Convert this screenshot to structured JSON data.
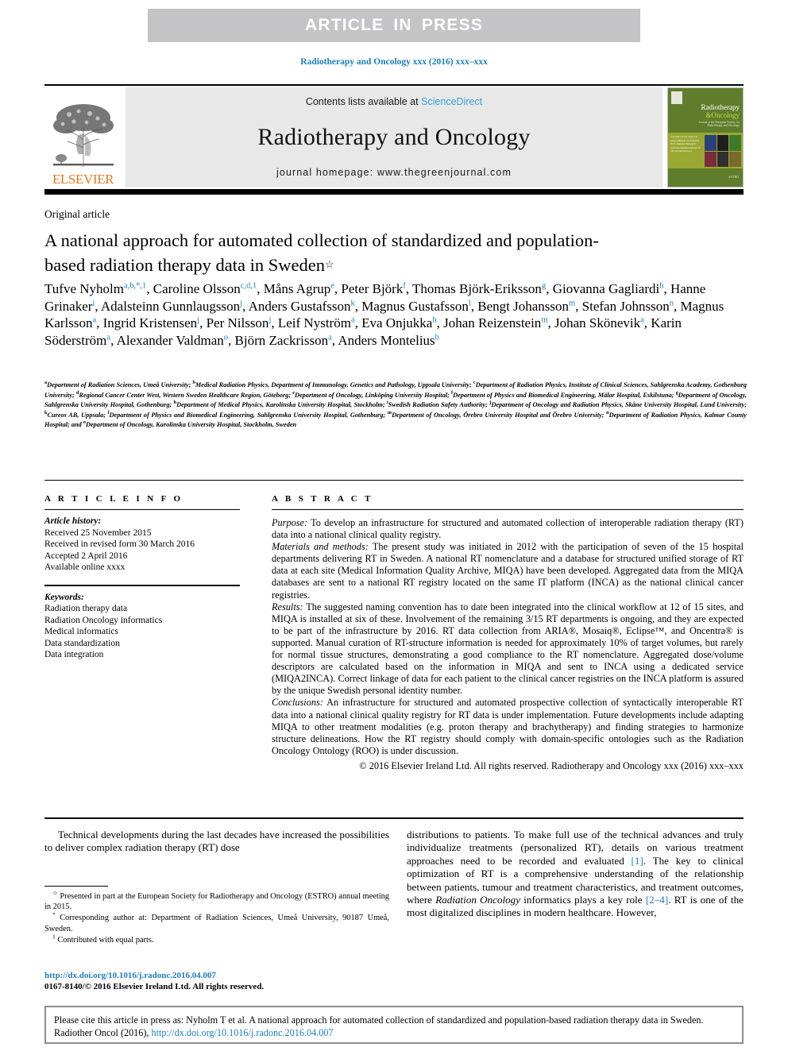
{
  "banner": {
    "label": "ARTICLE IN PRESS"
  },
  "running_head": "Radiotherapy and Oncology xxx (2016) xxx–xxx",
  "masthead": {
    "publisher_wordmark": "ELSEVIER",
    "contents_prefix": "Contents lists available at ",
    "contents_link": "ScienceDirect",
    "journal_name": "Radiotherapy and Oncology",
    "homepage_line": "journal homepage: www.thegreenjournal.com",
    "cover": {
      "title_line1": "Radiotherapy",
      "title_line2": "&Oncology",
      "subtitle": "Journal of the European Society for Radiotherapy and Oncology",
      "blurb": "Towards a Low-dose CT-based Method for Treating HCC Patients Research episodes metamorphoses of 2D reconstruction q",
      "footer_logo": "ESTRO"
    }
  },
  "article_type": "Original article",
  "title": {
    "text": "A national approach for automated collection of standardized and population-based radiation therapy data in Sweden",
    "footnote_marker": "☆"
  },
  "authors": [
    {
      "name": "Tufve Nyholm",
      "marks": "a,b,*,1",
      "sep": ", "
    },
    {
      "name": "Caroline Olsson",
      "marks": "c,d,1",
      "sep": ", "
    },
    {
      "name": "Måns Agrup",
      "marks": "e",
      "sep": ", "
    },
    {
      "name": "Peter Björk",
      "marks": "f",
      "sep": ", "
    },
    {
      "name": "Thomas Björk-Eriksson",
      "marks": "g",
      "sep": ", "
    },
    {
      "name": "Giovanna Gagliardi",
      "marks": "h",
      "sep": ", "
    },
    {
      "name": "Hanne Grinaker",
      "marks": "i",
      "sep": ", "
    },
    {
      "name": "Adalsteinn Gunnlaugsson",
      "marks": "j",
      "sep": ", "
    },
    {
      "name": "Anders Gustafsson",
      "marks": "k",
      "sep": ", "
    },
    {
      "name": "Magnus Gustafsson",
      "marks": "l",
      "sep": ", "
    },
    {
      "name": "Bengt Johansson",
      "marks": "m",
      "sep": ", "
    },
    {
      "name": "Stefan Johnsson",
      "marks": "n",
      "sep": ", "
    },
    {
      "name": "Magnus Karlsson",
      "marks": "a",
      "sep": ", "
    },
    {
      "name": "Ingrid Kristensen",
      "marks": "j",
      "sep": ", "
    },
    {
      "name": "Per Nilsson",
      "marks": "j",
      "sep": ", "
    },
    {
      "name": "Leif Nyström",
      "marks": "a",
      "sep": ", "
    },
    {
      "name": "Eva Onjukka",
      "marks": "h",
      "sep": ", "
    },
    {
      "name": "Johan Reizenstein",
      "marks": "m",
      "sep": ", "
    },
    {
      "name": "Johan Skönevik",
      "marks": "a",
      "sep": ", "
    },
    {
      "name": "Karin Söderström",
      "marks": "a",
      "sep": ", "
    },
    {
      "name": "Alexander Valdman",
      "marks": "o",
      "sep": ", "
    },
    {
      "name": "Björn Zackrisson",
      "marks": "a",
      "sep": ", "
    },
    {
      "name": "Anders Montelius",
      "marks": "b",
      "sep": ""
    }
  ],
  "affiliations": [
    {
      "mark": "a",
      "text": "Department of Radiation Sciences, Umeå University; "
    },
    {
      "mark": "b",
      "text": "Medical Radiation Physics, Department of Immunology, Genetics and Pathology, Uppsala University; "
    },
    {
      "mark": "c",
      "text": "Department of Radiation Physics, Institute of Clinical Sciences, Sahlgrenska Academy, Gothenburg University; "
    },
    {
      "mark": "d",
      "text": "Regional Cancer Center West, Western Sweden Healthcare Region, Göteborg; "
    },
    {
      "mark": "e",
      "text": "Department of Oncology, Linköping University Hospital; "
    },
    {
      "mark": "f",
      "text": "Department of Physics and Biomedical Engineering, Mälar Hospital, Eskilstuna; "
    },
    {
      "mark": "g",
      "text": "Department of Oncology, Sahlgrenska University Hospital, Gothenburg; "
    },
    {
      "mark": "h",
      "text": "Department of Medical Physics, Karolinska University Hospital, Stockholm; "
    },
    {
      "mark": "i",
      "text": "Swedish Radiation Safety Authority; "
    },
    {
      "mark": "j",
      "text": "Department of Oncology and Radiation Physics, Skåne University Hospital, Lund University; "
    },
    {
      "mark": "k",
      "text": "Cureos AB, Uppsala; "
    },
    {
      "mark": "l",
      "text": "Department of Physics and Biomedical Engineering, Sahlgrenska University Hospital, Gothenburg; "
    },
    {
      "mark": "m",
      "text": "Department of Oncology, Örebro University Hospital and Örebro University; "
    },
    {
      "mark": "n",
      "text": "Department of Radiation Physics, Kalmar County Hospital; and "
    },
    {
      "mark": "o",
      "text": "Department of Oncology, Karolinska University Hospital, Stockholm, Sweden"
    }
  ],
  "article_info": {
    "heading": "A R T I C L E    I N F O",
    "history_label": "Article history:",
    "history": [
      "Received 25 November 2015",
      "Received in revised form 30 March 2016",
      "Accepted 2 April 2016",
      "Available online xxxx"
    ],
    "keywords_label": "Keywords:",
    "keywords": [
      "Radiation therapy data",
      "Radiation Oncology informatics",
      "Medical informatics",
      "Data standardization",
      "Data integration"
    ]
  },
  "abstract": {
    "heading": "A B S T R A C T",
    "sections": [
      {
        "label": "Purpose:",
        "body": " To develop an infrastructure for structured and automated collection of interoperable radiation therapy (RT) data into a national clinical quality registry."
      },
      {
        "label": "Materials and methods:",
        "body": " The present study was initiated in 2012 with the participation of seven of the 15 hospital departments delivering RT in Sweden. A national RT nomenclature and a database for structured unified storage of RT data at each site (Medical Information Quality Archive, MIQA) have been developed. Aggregated data from the MIQA databases are sent to a national RT registry located on the same IT platform (INCA) as the national clinical cancer registries."
      },
      {
        "label": "Results:",
        "body": " The suggested naming convention has to date been integrated into the clinical workflow at 12 of 15 sites, and MIQA is installed at six of these. Involvement of the remaining 3/15 RT departments is ongoing, and they are expected to be part of the infrastructure by 2016. RT data collection from ARIA®, Mosaiq®, Eclipse™, and Oncentra® is supported. Manual curation of RT-structure information is needed for approximately 10% of target volumes, but rarely for normal tissue structures, demonstrating a good compliance to the RT nomenclature. Aggregated dose/volume descriptors are calculated based on the information in MIQA and sent to INCA using a dedicated service (MIQA2INCA). Correct linkage of data for each patient to the clinical cancer registries on the INCA platform is assured by the unique Swedish personal identity number."
      },
      {
        "label": "Conclusions:",
        "body": " An infrastructure for structured and automated prospective collection of syntactically interoperable RT data into a national clinical quality registry for RT data is under implementation. Future developments include adapting MIQA to other treatment modalities (e.g. proton therapy and brachytherapy) and finding strategies to harmonize structure delineations. How the RT registry should comply with domain-specific ontologies such as the Radiation Oncology Ontology (ROO) is under discussion."
      }
    ],
    "copyright": "© 2016 Elsevier Ireland Ltd. All rights reserved. Radiotherapy and Oncology xxx (2016) xxx–xxx"
  },
  "body": {
    "left_paragraph": "Technical developments during the last decades have increased the possibilities to deliver complex radiation therapy (RT) dose",
    "right_paragraph_part1": "distributions to patients. To make full use of the technical advances and truly individualize treatments (personalized RT), details on various treatment approaches need to be recorded and evaluated ",
    "right_ref1": "[1]",
    "right_paragraph_part2": ". The key to clinical optimization of RT is a comprehensive understanding of the relationship between patients, tumour and treatment characteristics, and treatment outcomes, where ",
    "right_italic": "Radiation Oncology",
    "right_paragraph_part3": " informatics plays a key role ",
    "right_ref2": "[2–4]",
    "right_paragraph_part4": ". RT is one of the most digitalized disciplines in modern healthcare. However,"
  },
  "footnotes": [
    {
      "mark": "☆",
      "text": " Presented in part at the European Society for Radiotherapy and Oncology (ESTRO) annual meeting in 2015."
    },
    {
      "mark": "*",
      "text": " Corresponding author at: Department of Radiation Sciences, Umeå University, 90187 Umeå, Sweden."
    },
    {
      "mark": "1",
      "text": " Contributed with equal parts."
    }
  ],
  "doi_line": "http://dx.doi.org/10.1016/j.radonc.2016.04.007",
  "issn_line": "0167-8140/© 2016 Elsevier Ireland Ltd. All rights reserved.",
  "cite_box": {
    "text": "Please cite this article in press as: Nyholm T et al. A national approach for automated collection of standardized and population-based radiation therapy data in Sweden. Radiother Oncol (2016), ",
    "link": "http://dx.doi.org/10.1016/j.radonc.2016.04.007"
  },
  "colors": {
    "banner_bg": "#c4c4c6",
    "link_blue": "#1a7fbf",
    "sciencedirect_blue": "#3a9fd6",
    "elsevier_orange": "#e87722",
    "masthead_bg": "#e8e8e8",
    "cover_green": "#5f7d2b",
    "cover_olive": "#9aa832"
  }
}
